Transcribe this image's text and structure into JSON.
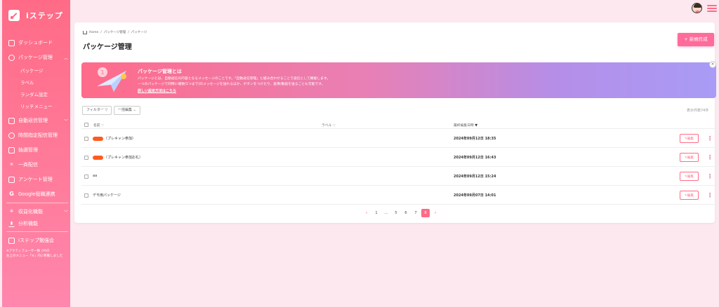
{
  "app": {
    "name": "iステップ"
  },
  "sidebar": {
    "items": [
      {
        "label": "ダッシュボード",
        "icon": "dashboard-icon"
      },
      {
        "label": "パッケージ管理",
        "icon": "package-icon",
        "expanded": true
      },
      {
        "label": "自動返信管理",
        "icon": "chat-icon"
      },
      {
        "label": "時間指定配信管理",
        "icon": "clock-icon"
      },
      {
        "label": "抽選管理",
        "icon": "gift-icon"
      },
      {
        "label": "一斉配信",
        "icon": "rss-icon"
      },
      {
        "label": "アンケート管理",
        "icon": "document-icon"
      },
      {
        "label": "Google役職連携",
        "icon": "google-icon"
      },
      {
        "label": "収益化機能",
        "icon": "monetize-icon"
      },
      {
        "label": "分析機能",
        "icon": "chart-icon"
      },
      {
        "label": "iステップ勉強会",
        "icon": "book-icon"
      }
    ],
    "subitems": [
      "パッケージ",
      "ラベル",
      "ランダム設定",
      "リッチメニュー"
    ],
    "note": "※アクティブユーザー数 が0の\n左上のメニュー「≡」内に移動しました"
  },
  "breadcrumb": [
    "Home",
    "パッケージ管理",
    "パッケージ"
  ],
  "page": {
    "title": "パッケージ管理",
    "new_button": "+ 新規作成"
  },
  "banner": {
    "title": "パッケージ管理とは",
    "desc1": "パッケージとは、自動返信の内容となるメッセージのことです。「自動返信管理」と組み合わせることで返信として機能します。",
    "desc2": "一つのパッケージで同時に複数(1つまで)のメッセージを送れるほか、ボタンをつけたり、画像/動画を送ることも可能です。",
    "link": "詳しい設定方法はこちら"
  },
  "filters": {
    "filter_label": "フィルター",
    "bulk_label": "一括編集",
    "count": "表示件数74件"
  },
  "table": {
    "headers": {
      "name": "名前",
      "label": "ラベル",
      "updated": "最終編集日時"
    },
    "rows": [
      {
        "name": "（プレキャン参加）",
        "redacted": true,
        "date": "2024年09月12日 18:35"
      },
      {
        "name": "（プレキャン参加お礼）",
        "redacted": true,
        "date": "2024年09月12日 16:43"
      },
      {
        "name": "aa",
        "redacted": false,
        "date": "2024年09月12日 15:24"
      },
      {
        "name": "デモ用パッケージ",
        "redacted": false,
        "date": "2024年09月07日 14:01"
      }
    ],
    "edit_label": "編集"
  },
  "pagination": {
    "pages": [
      "1",
      "...",
      "5",
      "6",
      "7",
      "8"
    ],
    "current": "8"
  },
  "colors": {
    "accent": "#ff6b86",
    "redact": "#ff5a1f"
  }
}
